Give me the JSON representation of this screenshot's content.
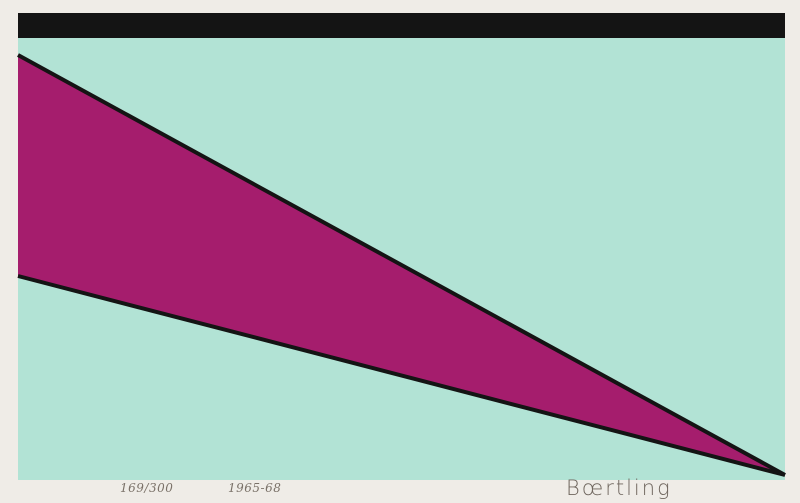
{
  "print": {
    "edition": "169/300",
    "date": "1965-68",
    "signature": "Bœrtling"
  },
  "colors": {
    "paper": "#efece7",
    "field": "#b2e3d5",
    "wedge": "#a51d6d",
    "line": "#141414"
  }
}
